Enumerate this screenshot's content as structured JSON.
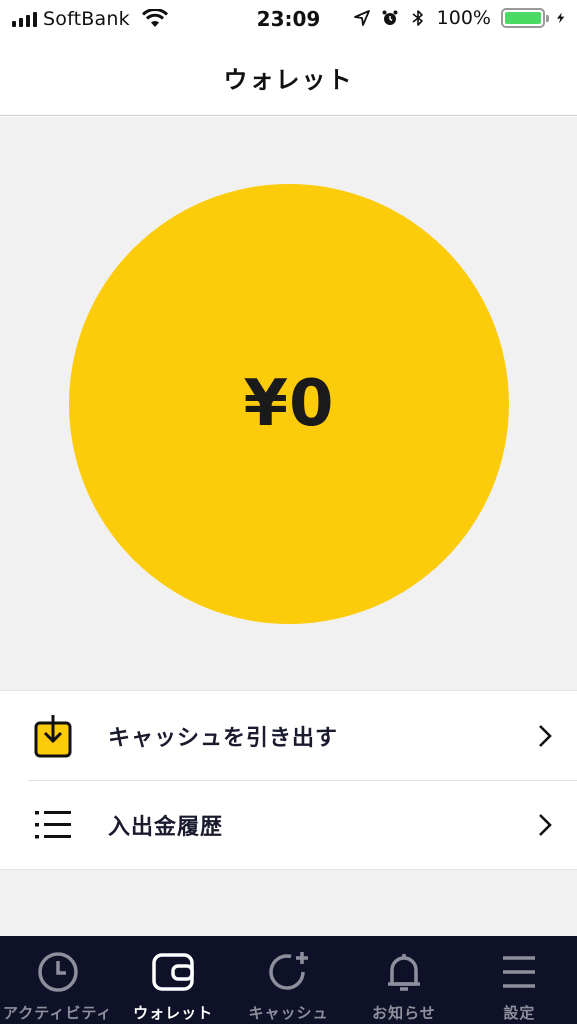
{
  "status_bar": {
    "carrier": "SoftBank",
    "time": "23:09",
    "battery_percent": "100%",
    "battery_level": 1.0,
    "icons": [
      "signal-icon",
      "wifi-icon",
      "location-icon",
      "alarm-icon",
      "bluetooth-icon",
      "battery-icon",
      "charging-icon"
    ]
  },
  "header": {
    "title": "ウォレット"
  },
  "balance": {
    "amount": "¥0",
    "circle_color": "#fccb09"
  },
  "menu": {
    "items": [
      {
        "label": "キャッシュを引き出す",
        "icon": "withdraw-icon"
      },
      {
        "label": "入出金履歴",
        "icon": "list-icon"
      }
    ]
  },
  "tab_bar": {
    "background": "#0f1128",
    "tabs": [
      {
        "label": "アクティビティ",
        "icon": "clock-icon",
        "active": false
      },
      {
        "label": "ウォレット",
        "icon": "wallet-icon",
        "active": true
      },
      {
        "label": "キャッシュ",
        "icon": "cash-add-icon",
        "active": false
      },
      {
        "label": "お知らせ",
        "icon": "bell-icon",
        "active": false
      },
      {
        "label": "設定",
        "icon": "menu-icon",
        "active": false
      }
    ]
  }
}
